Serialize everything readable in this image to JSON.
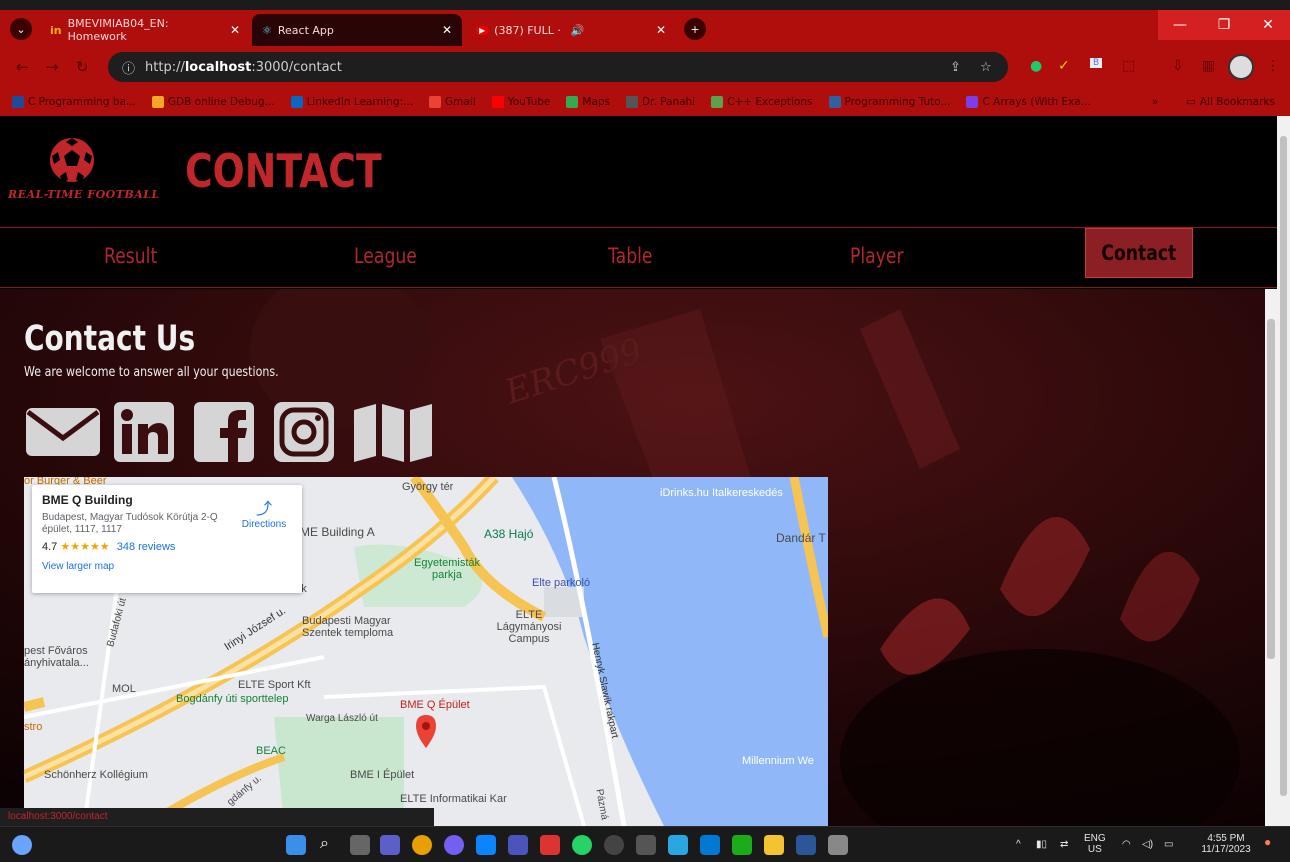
{
  "browser": {
    "tabs": [
      {
        "label": "BMEVIMIAB04_EN: Homework"
      },
      {
        "label": "React App"
      },
      {
        "label": "(387) FULL ·"
      }
    ],
    "url_prefix": "http://",
    "url_host": "localhost",
    "url_path": ":3000/contact",
    "bookmarks": [
      "C Programming ba...",
      "GDB online Debug...",
      "LinkedIn Learning:...",
      "Gmail",
      "YouTube",
      "Maps",
      "Dr. Panahi",
      "C++ Exceptions",
      "Programming Tuto...",
      "C Arrays (With Exa..."
    ],
    "all_bookmarks": "All Bookmarks",
    "status_url": "localhost:3000/contact",
    "accent_color": "#b00d0d"
  },
  "site": {
    "logo_text": "REAL-TIME FOOTBALL",
    "page_title": "CONTACT",
    "nav": [
      "Result",
      "League",
      "Table",
      "Player",
      "Contact"
    ],
    "active_nav": "Contact",
    "brand_color": "#c0262a"
  },
  "contact": {
    "title": "Contact Us",
    "subtitle": "We are welcome to answer all your questions.",
    "icons": [
      "envelope-icon",
      "linkedin-icon",
      "facebook-icon",
      "instagram-icon",
      "map-icon"
    ]
  },
  "map": {
    "place_name": "BME Q Building",
    "address": "Budapest, Magyar Tudósok Körútja 2-Q épület, 1117, 1117",
    "rating": "4.7",
    "stars": "★★★★★",
    "reviews": "348 reviews",
    "directions": "Directions",
    "larger_map": "View larger map",
    "labels": {
      "burger": "or Burger & Beer",
      "gyorgy": "György tér",
      "idrinks": "iDrinks.hu Italkereskedés",
      "bme_a": "ME Building A",
      "a38": "A38 Hajó",
      "dandar": "Dandár T",
      "egyetemistak": "Egyetemisták parkja",
      "elte_parkolo": "Elte parkoló",
      "science_park": "Science Park",
      "irinyi": "Irinyi József u.",
      "budafoki": "Budafoki út",
      "templom": "Budapesti Magyar Szentek temploma",
      "elte_lagy": "ELTE Lágymányosi Campus",
      "fovaros": "pest Főváros ányhivatala...",
      "mol": "MOL",
      "elte_sport": "ELTE Sport Kft",
      "bogdanfy": "Bogdánfy úti sporttelep",
      "bme_q": "BME Q Épület",
      "warga": "Warga László út",
      "henryk": "Henryk Slawik rakpart",
      "stro": "stro",
      "beac": "BEAC",
      "schonherz": "Schönherz Kollégium",
      "bme_i": "BME I Épület",
      "elte_inf": "ELTE Informatikai Kar",
      "millennium": "Millennium We",
      "pazm": "Pázmá",
      "bogdanfy_u": "gdánfy u."
    }
  },
  "taskbar": {
    "lang": "ENG",
    "region": "US",
    "time": "4:55 PM",
    "date": "11/17/2023"
  }
}
